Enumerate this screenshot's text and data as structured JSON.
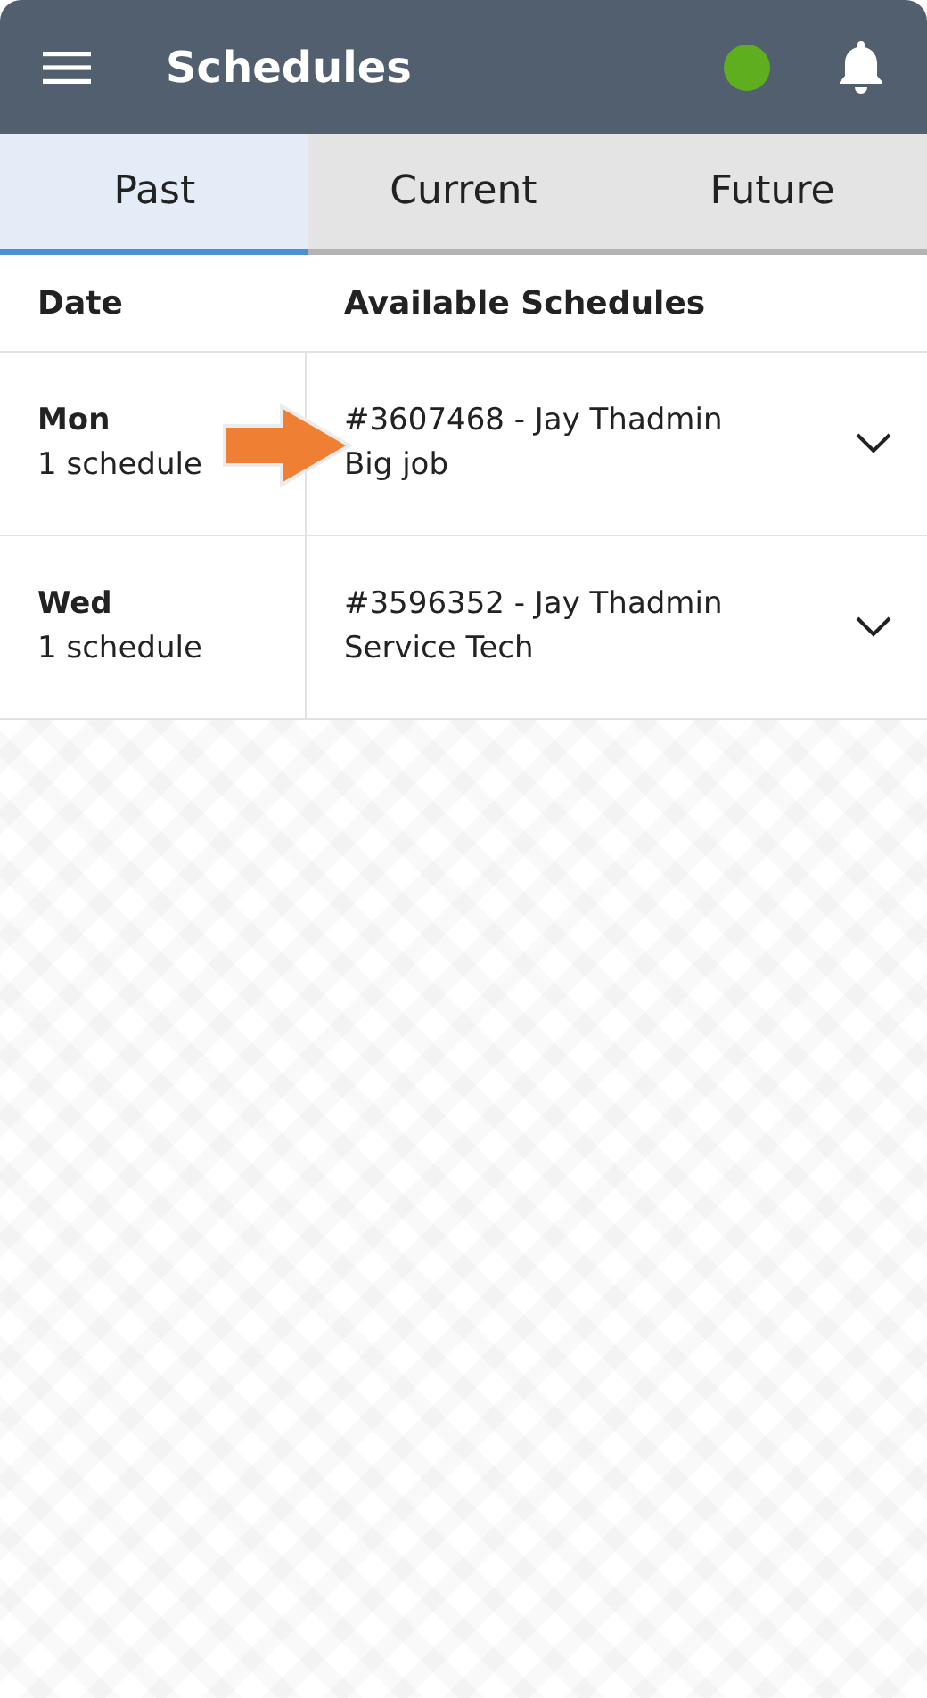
{
  "header": {
    "title": "Schedules"
  },
  "tabs": [
    {
      "label": "Past",
      "selected": true
    },
    {
      "label": "Current",
      "selected": false
    },
    {
      "label": "Future",
      "selected": false
    }
  ],
  "table": {
    "columns": [
      "Date",
      "Available Schedules"
    ],
    "rows": [
      {
        "day": "Mon",
        "count": "1 schedule",
        "schedule": "#3607468 - Jay Thadmin",
        "subtitle": "Big job",
        "expanded": false,
        "pointer": true
      },
      {
        "day": "Wed",
        "count": "1 schedule",
        "schedule": "#3596352 - Jay Thadmin",
        "subtitle": "Service Tech",
        "expanded": false
      }
    ]
  }
}
